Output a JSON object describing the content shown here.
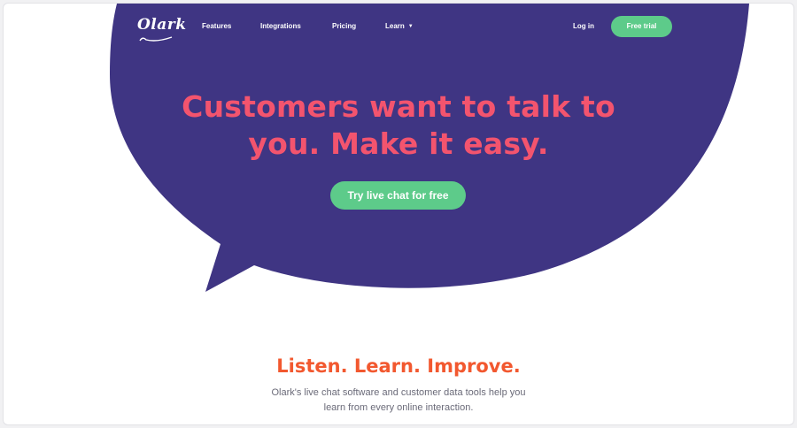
{
  "nav": {
    "logo": "Olark",
    "links": [
      "Features",
      "Integrations",
      "Pricing",
      "Learn"
    ],
    "login": "Log in",
    "cta": "Free trial"
  },
  "hero": {
    "headline_line1": "Customers want to talk to",
    "headline_line2": "you. Make it easy.",
    "cta": "Try live chat for free"
  },
  "section": {
    "title": "Listen. Learn. Improve.",
    "description_line1": "Olark's live chat software and customer data tools help you",
    "description_line2": "learn from every online interaction."
  },
  "colors": {
    "bubble": "#3f3583",
    "headline": "#f3546e",
    "accent_green": "#5dcb8a",
    "section_title": "#f2582f",
    "body_text": "#6a6a78"
  },
  "icons": {
    "learn_dropdown": "caret-down-icon",
    "logo": "olark-logo"
  }
}
